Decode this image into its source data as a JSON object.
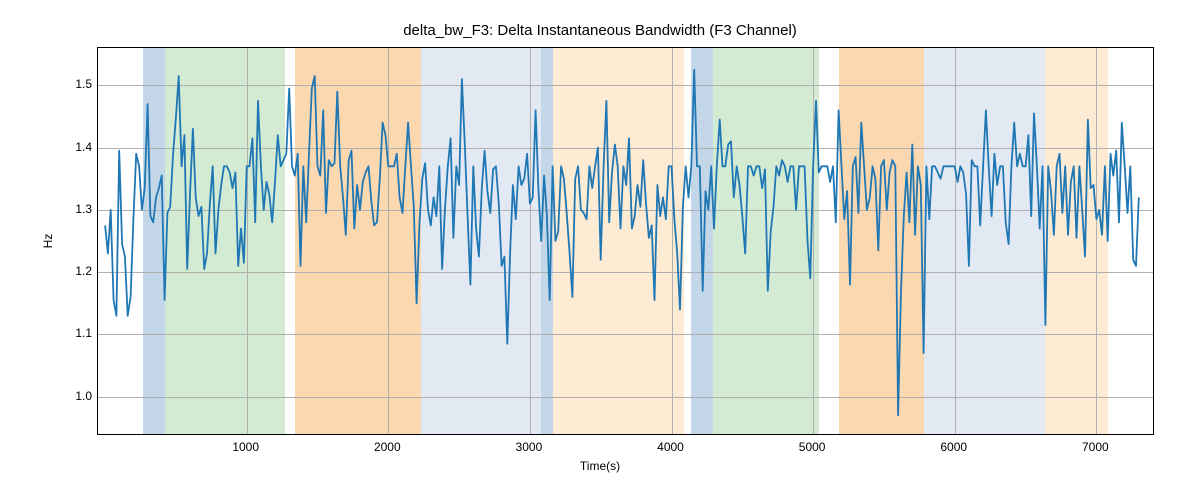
{
  "chart_data": {
    "type": "line",
    "title": "delta_bw_F3: Delta Instantaneous Bandwidth (F3 Channel)",
    "xlabel": "Time(s)",
    "ylabel": "Hz",
    "xlim": [
      -50,
      7400
    ],
    "ylim": [
      0.94,
      1.56
    ],
    "xticks": [
      1000,
      2000,
      3000,
      4000,
      5000,
      6000,
      7000
    ],
    "yticks": [
      1.0,
      1.1,
      1.2,
      1.3,
      1.4,
      1.5
    ],
    "bands": [
      {
        "x0": 270,
        "x1": 420,
        "class": "band-blue"
      },
      {
        "x0": 420,
        "x1": 1270,
        "class": "band-green"
      },
      {
        "x0": 1340,
        "x1": 2230,
        "class": "band-orange"
      },
      {
        "x0": 2230,
        "x1": 3080,
        "class": "band-lightblue"
      },
      {
        "x0": 3080,
        "x1": 3160,
        "class": "band-blue"
      },
      {
        "x0": 3160,
        "x1": 4090,
        "class": "band-cream"
      },
      {
        "x0": 4140,
        "x1": 4290,
        "class": "band-blue"
      },
      {
        "x0": 4290,
        "x1": 5040,
        "class": "band-green"
      },
      {
        "x0": 5180,
        "x1": 5780,
        "class": "band-orange"
      },
      {
        "x0": 5780,
        "x1": 6640,
        "class": "band-lightblue"
      },
      {
        "x0": 6640,
        "x1": 7080,
        "class": "band-cream"
      }
    ],
    "series": [
      {
        "name": "delta_bw_F3",
        "color": "#1f77b4",
        "x_start": 0,
        "x_step": 20,
        "values": [
          1.275,
          1.23,
          1.3,
          1.155,
          1.13,
          1.395,
          1.245,
          1.225,
          1.13,
          1.16,
          1.285,
          1.39,
          1.37,
          1.3,
          1.335,
          1.47,
          1.29,
          1.28,
          1.32,
          1.335,
          1.355,
          1.155,
          1.295,
          1.305,
          1.39,
          1.448,
          1.515,
          1.37,
          1.42,
          1.205,
          1.325,
          1.43,
          1.32,
          1.29,
          1.305,
          1.205,
          1.23,
          1.31,
          1.37,
          1.23,
          1.3,
          1.34,
          1.37,
          1.37,
          1.36,
          1.335,
          1.36,
          1.21,
          1.27,
          1.215,
          1.37,
          1.37,
          1.415,
          1.28,
          1.475,
          1.37,
          1.3,
          1.345,
          1.325,
          1.28,
          1.345,
          1.42,
          1.37,
          1.38,
          1.39,
          1.495,
          1.37,
          1.355,
          1.39,
          1.21,
          1.37,
          1.28,
          1.39,
          1.495,
          1.515,
          1.37,
          1.355,
          1.46,
          1.295,
          1.38,
          1.37,
          1.375,
          1.49,
          1.37,
          1.32,
          1.26,
          1.38,
          1.395,
          1.27,
          1.34,
          1.3,
          1.345,
          1.36,
          1.37,
          1.315,
          1.275,
          1.28,
          1.35,
          1.44,
          1.42,
          1.37,
          1.37,
          1.37,
          1.39,
          1.32,
          1.295,
          1.37,
          1.44,
          1.37,
          1.305,
          1.15,
          1.28,
          1.35,
          1.375,
          1.3,
          1.275,
          1.32,
          1.29,
          1.37,
          1.205,
          1.3,
          1.37,
          1.415,
          1.255,
          1.37,
          1.34,
          1.51,
          1.405,
          1.29,
          1.18,
          1.37,
          1.27,
          1.225,
          1.335,
          1.395,
          1.33,
          1.295,
          1.365,
          1.37,
          1.31,
          1.21,
          1.225,
          1.085,
          1.23,
          1.34,
          1.285,
          1.37,
          1.34,
          1.35,
          1.39,
          1.31,
          1.32,
          1.46,
          1.335,
          1.25,
          1.355,
          1.29,
          1.155,
          1.37,
          1.25,
          1.265,
          1.37,
          1.35,
          1.295,
          1.23,
          1.16,
          1.35,
          1.37,
          1.3,
          1.295,
          1.285,
          1.37,
          1.335,
          1.37,
          1.4,
          1.22,
          1.37,
          1.475,
          1.28,
          1.36,
          1.405,
          1.37,
          1.27,
          1.37,
          1.34,
          1.415,
          1.27,
          1.29,
          1.34,
          1.305,
          1.38,
          1.31,
          1.255,
          1.275,
          1.155,
          1.34,
          1.29,
          1.32,
          1.285,
          1.37,
          1.37,
          1.285,
          1.23,
          1.14,
          1.305,
          1.37,
          1.32,
          1.37,
          1.525,
          1.37,
          1.37,
          1.17,
          1.33,
          1.3,
          1.37,
          1.27,
          1.37,
          1.445,
          1.37,
          1.37,
          1.405,
          1.41,
          1.32,
          1.37,
          1.34,
          1.29,
          1.23,
          1.37,
          1.37,
          1.355,
          1.37,
          1.37,
          1.335,
          1.365,
          1.17,
          1.265,
          1.305,
          1.37,
          1.355,
          1.38,
          1.37,
          1.345,
          1.37,
          1.37,
          1.3,
          1.37,
          1.37,
          1.37,
          1.25,
          1.19,
          1.37,
          1.475,
          1.36,
          1.37,
          1.37,
          1.37,
          1.345,
          1.37,
          1.28,
          1.46,
          1.37,
          1.285,
          1.33,
          1.18,
          1.37,
          1.385,
          1.295,
          1.44,
          1.37,
          1.3,
          1.32,
          1.37,
          1.35,
          1.235,
          1.37,
          1.38,
          1.3,
          1.36,
          1.38,
          1.37,
          0.97,
          1.165,
          1.29,
          1.36,
          1.28,
          1.405,
          1.26,
          1.37,
          1.34,
          1.07,
          1.37,
          1.285,
          1.37,
          1.37,
          1.36,
          1.35,
          1.37,
          1.37,
          1.37,
          1.37,
          1.37,
          1.345,
          1.37,
          1.36,
          1.325,
          1.21,
          1.38,
          1.37,
          1.37,
          1.275,
          1.37,
          1.46,
          1.37,
          1.29,
          1.39,
          1.34,
          1.37,
          1.37,
          1.28,
          1.245,
          1.37,
          1.44,
          1.37,
          1.39,
          1.37,
          1.37,
          1.42,
          1.29,
          1.455,
          1.37,
          1.27,
          1.37,
          1.115,
          1.37,
          1.33,
          1.26,
          1.37,
          1.39,
          1.295,
          1.37,
          1.26,
          1.345,
          1.37,
          1.255,
          1.37,
          1.3,
          1.225,
          1.445,
          1.335,
          1.34,
          1.285,
          1.3,
          1.26,
          1.37,
          1.25,
          1.39,
          1.355,
          1.395,
          1.28,
          1.44,
          1.37,
          1.295,
          1.37,
          1.22,
          1.21,
          1.32
        ]
      }
    ]
  }
}
